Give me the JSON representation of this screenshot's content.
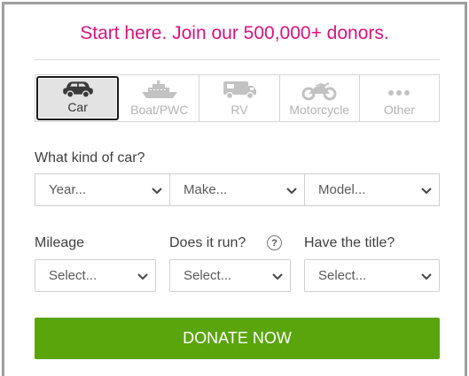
{
  "headline": "Start here. Join our 500,000+ donors.",
  "vehicle_types": [
    {
      "label": "Car",
      "icon": "car-icon",
      "selected": true
    },
    {
      "label": "Boat/PWC",
      "icon": "boat-icon",
      "selected": false
    },
    {
      "label": "RV",
      "icon": "rv-icon",
      "selected": false
    },
    {
      "label": "Motorcycle",
      "icon": "motorcycle-icon",
      "selected": false
    },
    {
      "label": "Other",
      "icon": "more-dots-icon",
      "selected": false
    }
  ],
  "car_section": {
    "label": "What kind of car?",
    "year_value": "Year...",
    "make_value": "Make...",
    "model_value": "Model..."
  },
  "details": {
    "mileage_label": "Mileage",
    "runs_label": "Does it run?",
    "title_label": "Have the title?",
    "mileage_value": "Select...",
    "runs_value": "Select...",
    "title_value": "Select...",
    "help_glyph": "?"
  },
  "donate_button": "DONATE NOW",
  "colors": {
    "headline": "#d8127e",
    "button": "#5aa50b",
    "frame": "#9e9e9e"
  }
}
